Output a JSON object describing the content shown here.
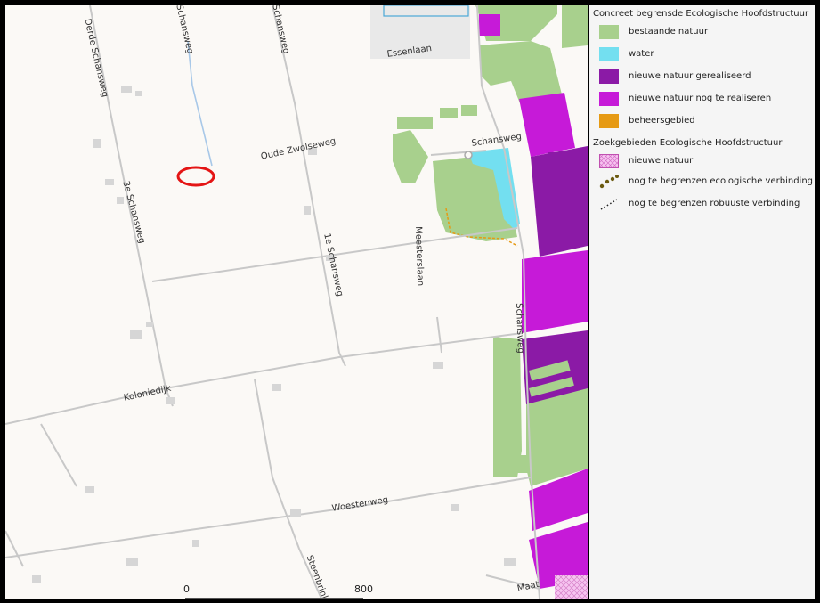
{
  "map": {
    "road_labels": {
      "derde_schansweg": "Derde Schansweg",
      "schansweg_top": "Schansweg",
      "schansweg_top2": "Schansweg",
      "essenlaan": "Essenlaan",
      "oude_zwolseweg": "Oude Zwolseweg",
      "schansweg_mid": "Schansweg",
      "third_schansweg": "3e Schansweg",
      "first_schansweg": "1e Schansweg",
      "meesterslaan": "Meesterslaan",
      "koloniedijk": "Koloniedijk",
      "schansweg_right": "Schansweg",
      "woestenweg": "Woestenweg",
      "steenbrink": "Steenbrink",
      "maat": "Maat"
    },
    "colors": {
      "background": "#fbf9f6",
      "road": "#c8c8c8",
      "existing_nature": "#a8d08d",
      "water": "#73dff0",
      "new_nature_realised": "#8b1aa6",
      "new_nature_to_realise": "#c61ad8",
      "management_area": "#e69a14",
      "marker": "#e41515",
      "search_nature": "#f6c4f0"
    }
  },
  "scale": {
    "start": "0",
    "end": "800 m"
  },
  "legend": {
    "section1_title": "Concreet begrensde Ecologische Hoofdstructuur",
    "items1": [
      {
        "label": "bestaande natuur",
        "color": "#a8d08d"
      },
      {
        "label": "water",
        "color": "#73dff0"
      },
      {
        "label": "nieuwe natuur gerealiseerd",
        "color": "#8b1aa6"
      },
      {
        "label": "nieuwe natuur nog te realiseren",
        "color": "#c61ad8"
      },
      {
        "label": "beheersgebied",
        "color": "#e69a14"
      }
    ],
    "section2_title": "Zoekgebieden Ecologische Hoofdstructuur",
    "items2": [
      {
        "label": "nieuwe natuur",
        "icon": "hatched-pink-icon"
      },
      {
        "label": "nog te begrenzen ecologische verbinding",
        "icon": "dotted-brown-icon"
      },
      {
        "label": "nog te begrenzen robuuste verbinding",
        "icon": "dotted-black-icon"
      }
    ]
  }
}
